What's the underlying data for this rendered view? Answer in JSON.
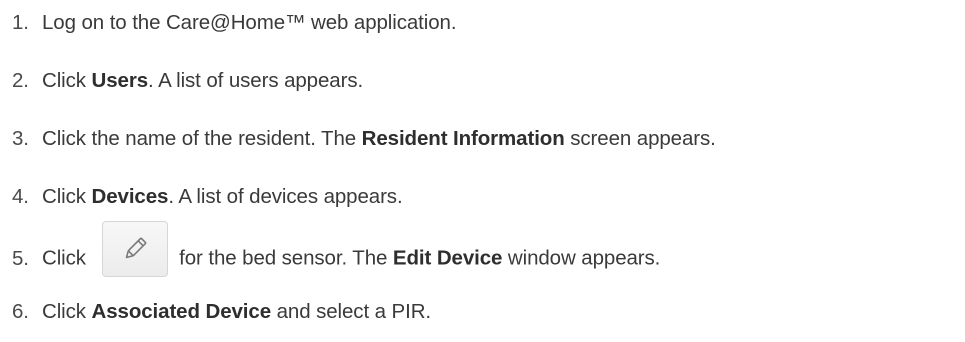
{
  "steps": [
    {
      "number": "1.",
      "parts": [
        {
          "text": "Log on to the Care@Home™ web application.",
          "bold": false
        }
      ]
    },
    {
      "number": "2.",
      "parts": [
        {
          "text": "Click ",
          "bold": false
        },
        {
          "text": "Users",
          "bold": true
        },
        {
          "text": ". A list of users appears.",
          "bold": false
        }
      ]
    },
    {
      "number": "3.",
      "parts": [
        {
          "text": "Click the name of the resident. The ",
          "bold": false
        },
        {
          "text": "Resident Information",
          "bold": true
        },
        {
          "text": " screen appears.",
          "bold": false
        }
      ]
    },
    {
      "number": "4.",
      "parts": [
        {
          "text": "Click ",
          "bold": false
        },
        {
          "text": "Devices",
          "bold": true
        },
        {
          "text": ". A list of devices appears.",
          "bold": false
        }
      ]
    },
    {
      "number": "5.",
      "before": "Click",
      "icon": "pencil-edit-icon",
      "parts": [
        {
          "text": "for the bed sensor. The ",
          "bold": false
        },
        {
          "text": "Edit Device",
          "bold": true
        },
        {
          "text": " window appears.",
          "bold": false
        }
      ]
    },
    {
      "number": "6.",
      "parts": [
        {
          "text": "Click ",
          "bold": false
        },
        {
          "text": "Associated Device",
          "bold": true
        },
        {
          "text": " and select a PIR.",
          "bold": false
        }
      ]
    }
  ]
}
